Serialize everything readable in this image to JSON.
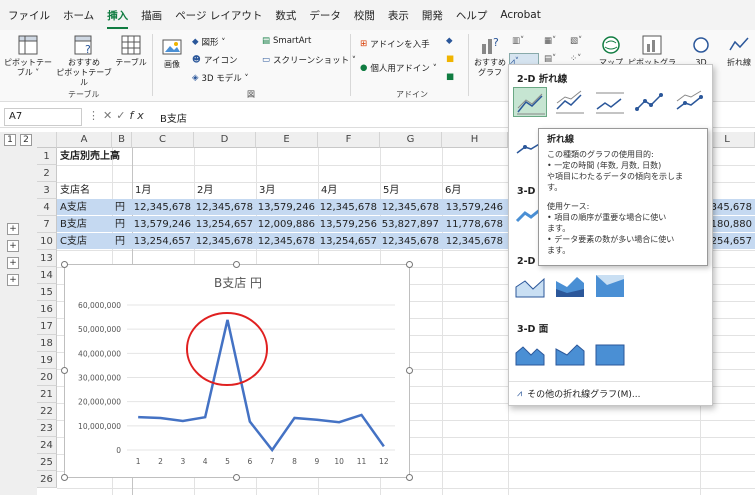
{
  "menu": [
    "ファイル",
    "ホーム",
    "挿入",
    "描画",
    "ページ レイアウト",
    "数式",
    "データ",
    "校閲",
    "表示",
    "開発",
    "ヘルプ",
    "Acrobat"
  ],
  "ribbon": {
    "pivot_table": "ピボットテー\nブル ˅",
    "recommended_pivot": "おすすめ\nピボットテーブル",
    "table": "テーブル",
    "group_table": "テーブル",
    "images": "画像",
    "shapes": "図形 ˅",
    "icons": "アイコン",
    "models_3d": "3D モデル ˅",
    "smartart": "SmartArt",
    "screenshot": "スクリーンショット ˅",
    "group_figure": "図",
    "get_addins": "アドインを入手",
    "personal_addins": "個人用アドイン ˅",
    "group_addin": "アドイン",
    "recommended_charts": "おすすめ\nグラフ",
    "maps": "マップ",
    "pivot_chart": "ピボットグラフ",
    "map_3d": "3D",
    "sparkline": "折れ線"
  },
  "formula_bar": {
    "name_box": "A7",
    "content": "B支店",
    "fx": "fx"
  },
  "columns": [
    "A",
    "B",
    "C",
    "D",
    "E",
    "F",
    "G",
    "H",
    "I",
    "J",
    "K",
    "L"
  ],
  "rows": [
    "1",
    "2",
    "3",
    "4",
    "7",
    "10",
    "13",
    "14",
    "15",
    "16",
    "17",
    "18",
    "19",
    "20",
    "21",
    "22",
    "23",
    "24",
    "25",
    "26"
  ],
  "cells": {
    "title": "支店別売上高",
    "hdr_branch": "支店名",
    "months": [
      "1月",
      "2月",
      "3月",
      "4月",
      "5月",
      "6月"
    ],
    "data_rows": [
      {
        "name": "A支店",
        "unit": "円",
        "values": [
          "12,345,678",
          "12,345,678",
          "13,579,246",
          "12,345,678",
          "12,345,678",
          "13,579,246"
        ],
        "tail": "345,678"
      },
      {
        "name": "B支店",
        "unit": "円",
        "values": [
          "13,579,246",
          "13,254,657",
          "12,009,886",
          "13,579,256",
          "53,827,897",
          "11,778,678"
        ],
        "tail": "180,880"
      },
      {
        "name": "C支店",
        "unit": "円",
        "values": [
          "13,254,657",
          "12,345,678",
          "12,345,678",
          "13,254,657",
          "12,345,678",
          "12,345,678"
        ],
        "tail": "254,657"
      }
    ]
  },
  "outline_buttons": [
    "1",
    "2"
  ],
  "chart_data": {
    "type": "line",
    "title": "B支店 円",
    "x": [
      1,
      2,
      3,
      4,
      5,
      6,
      7,
      8,
      9,
      10,
      11,
      12
    ],
    "series": [
      {
        "values": [
          13579246,
          13254657,
          12009886,
          13579256,
          53827897,
          11778678,
          0,
          13254657,
          12500000,
          11500000,
          14500000,
          1500000
        ]
      }
    ],
    "ylim": [
      0,
      60000000
    ],
    "yticks": [
      "0",
      "10,000,000",
      "20,000,000",
      "30,000,000",
      "40,000,000",
      "50,000,000",
      "60,000,000"
    ],
    "color": "#4472c4",
    "annotation_color": "#e02020"
  },
  "dropdown": {
    "section_2d": "2-D 折れ線",
    "section_3d": "3-D 折れ線",
    "section_2d_area": "2-D 面",
    "section_3d_area": "3-D 面",
    "more": "その他の折れ線グラフ(M)..."
  },
  "tooltip": {
    "title": "折れ線",
    "l1": "この種類のグラフの使用目的:",
    "l2": "• 一定の時間 (年数, 月数, 日数)",
    "l3": "や項目にわたるデータの傾向を示しま",
    "l4": "す。",
    "l5": "使用ケース:",
    "l6": "• 項目の順序が重要な場合に使い",
    "l7": "ます。",
    "l8": "• データ要素の数が多い場合に使い",
    "l9": "ます。"
  }
}
